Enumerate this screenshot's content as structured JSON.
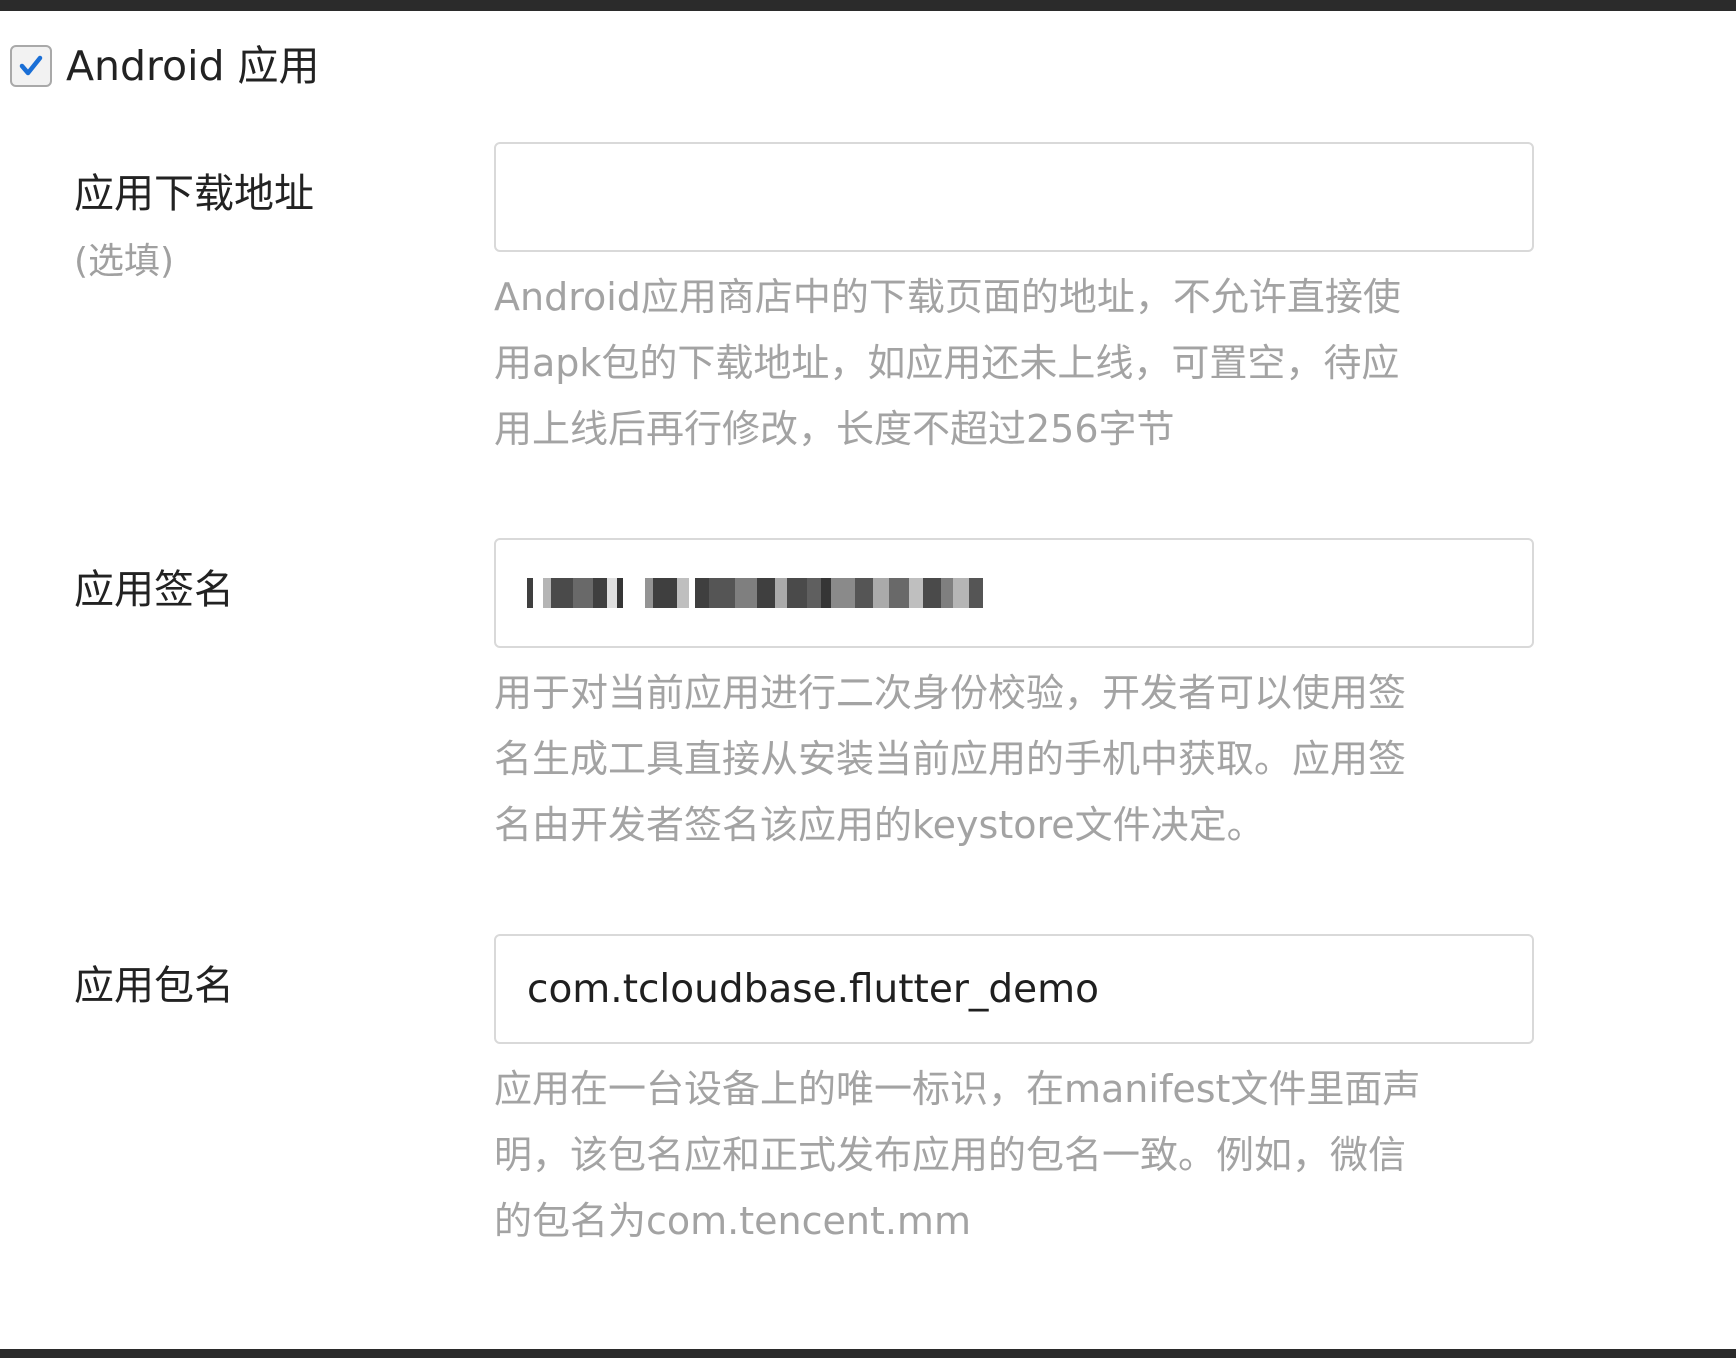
{
  "section": {
    "checkbox_label": "Android 应用",
    "checked": true,
    "accent_color": "#1a6fd6"
  },
  "download_url": {
    "label": "应用下载地址",
    "optional_note": "(选填)",
    "value": "",
    "help_lines": [
      "Android应用商店中的下载页面的地址，不允许直接使",
      "用apk包的下载地址，如应用还未上线，可置空，待应",
      "用上线后再行修改，长度不超过256字节"
    ]
  },
  "signature": {
    "label": "应用签名",
    "value_redacted": true,
    "help_lines": [
      "用于对当前应用进行二次身份校验，开发者可以使用签",
      "名生成工具直接从安装当前应用的手机中获取。应用签",
      "名由开发者签名该应用的keystore文件决定。"
    ]
  },
  "package_name": {
    "label": "应用包名",
    "value": "com.tcloudbase.flutter_demo",
    "help_lines": [
      "应用在一台设备上的唯一标识，在manifest文件里面声",
      "明，该包名应和正式发布应用的包名一致。例如，微信",
      "的包名为com.tencent.mm"
    ]
  }
}
